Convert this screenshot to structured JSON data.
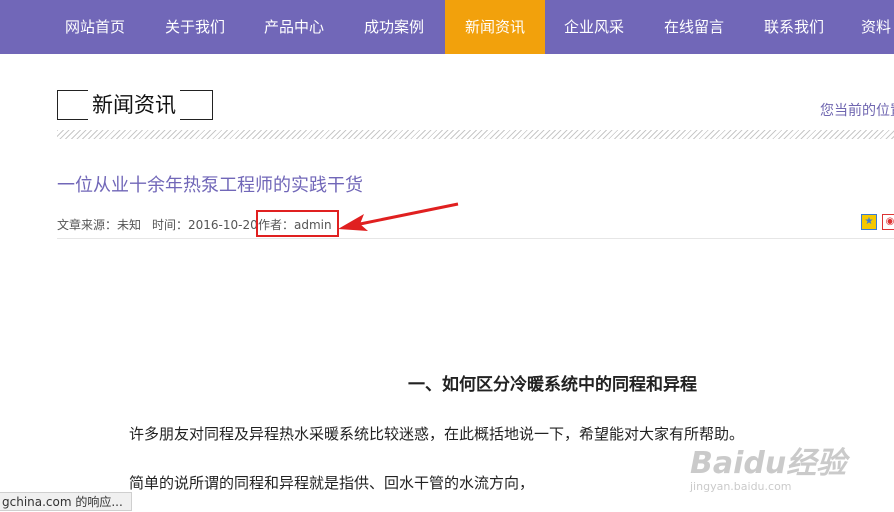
{
  "nav": {
    "items": [
      {
        "label": "网站首页",
        "active": false
      },
      {
        "label": "关于我们",
        "active": false
      },
      {
        "label": "产品中心",
        "active": false
      },
      {
        "label": "成功案例",
        "active": false
      },
      {
        "label": "新闻资讯",
        "active": true
      },
      {
        "label": "企业风采",
        "active": false
      },
      {
        "label": "在线留言",
        "active": false
      },
      {
        "label": "联系我们",
        "active": false
      },
      {
        "label": "资料",
        "active": false
      }
    ],
    "color": "#7167b8",
    "active_color": "#f2a10c"
  },
  "section": {
    "title": "新闻资讯",
    "location": "您当前的位置"
  },
  "article": {
    "title": "一位从业十余年热泵工程师的实践干货",
    "source": "文章来源：未知",
    "time": "时间：2016-10-20",
    "author": "作者：admin",
    "heading": "一、如何区分冷暖系统中的同程和异程",
    "paragraphs": [
      "许多朋友对同程及异程热水采暖系统比较迷惑，在此概括地说一下，希望能对大家有所帮助。",
      "简单的说所谓的同程和异程就是指供、回水干管的水流方向，"
    ]
  },
  "annotation": {
    "highlight_color": "#e02020"
  },
  "watermark": {
    "main": "Baidu经验",
    "sub": "jingyan.baidu.com"
  },
  "statusbar": {
    "text": "gchina.com 的响应..."
  },
  "icons": [
    "qzone-share-icon",
    "weibo-share-icon"
  ]
}
